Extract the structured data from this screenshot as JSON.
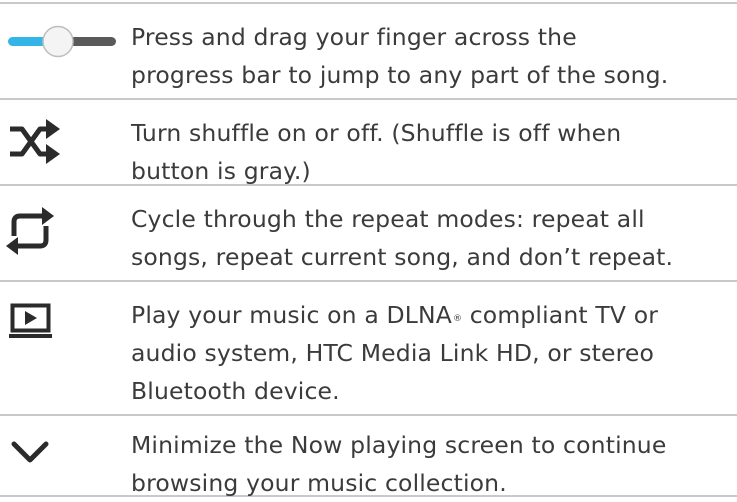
{
  "rows": [
    {
      "icon": "progress-slider-icon",
      "lines": [
        "Press and drag your finger across the",
        "progress bar to jump to any part of the song."
      ]
    },
    {
      "icon": "shuffle-icon",
      "lines": [
        "Turn shuffle on or off. (Shuffle is off when",
        "button is gray.)"
      ]
    },
    {
      "icon": "repeat-icon",
      "lines": [
        "Cycle through the repeat modes: repeat all",
        "songs, repeat current song, and don’t repeat."
      ]
    },
    {
      "icon": "play-on-screen-icon",
      "lines_with_mark": {
        "before": "Play your music on a DLNA",
        "mark": "®",
        "after": " compliant TV or"
      },
      "lines": [
        "audio system, HTC Media Link HD, or stereo",
        "Bluetooth device."
      ]
    },
    {
      "icon": "chevron-down-icon",
      "lines": [
        "Minimize the Now playing screen to continue",
        "browsing your music collection."
      ]
    }
  ],
  "colors": {
    "text": "#3b3b3b",
    "icon": "#2b2b2b",
    "slider_accent": "#33b5e5",
    "slider_track": "#5a5a5a",
    "divider": "#c9c9c9"
  }
}
